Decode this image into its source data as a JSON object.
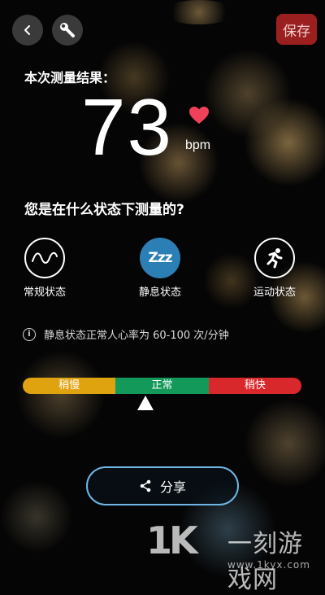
{
  "header": {
    "back_icon": "chevron-left-icon",
    "tools_icon": "wrench-icon",
    "save_label": "保存"
  },
  "result": {
    "label": "本次测量结果：",
    "value": "73",
    "unit": "bpm",
    "heart_icon": "heart-icon",
    "heart_color": "#f0415a"
  },
  "question": "您是在什么状态下测量的?",
  "states": [
    {
      "label": "常规状态",
      "icon": "wave-icon",
      "selected": false
    },
    {
      "label": "静息状态",
      "icon": "zzz-icon",
      "icon_text": "Zzz",
      "selected": true,
      "color": "#2b7fb5"
    },
    {
      "label": "运动状态",
      "icon": "running-icon",
      "selected": false
    }
  ],
  "info": {
    "icon": "info-icon",
    "icon_text": "i",
    "text": "静息状态正常人心率为 60-100 次/分钟"
  },
  "range": {
    "segments": [
      {
        "label": "稍慢",
        "color": "#e0a310"
      },
      {
        "label": "正常",
        "color": "#139a5b"
      },
      {
        "label": "稍快",
        "color": "#d8282b"
      }
    ]
  },
  "share": {
    "icon": "share-icon",
    "label": "分享",
    "border_color": "#6fb5e6"
  },
  "watermark": {
    "logo_text": "1K",
    "brand": "一刻游戏网",
    "url": "www.1kyx.com"
  }
}
